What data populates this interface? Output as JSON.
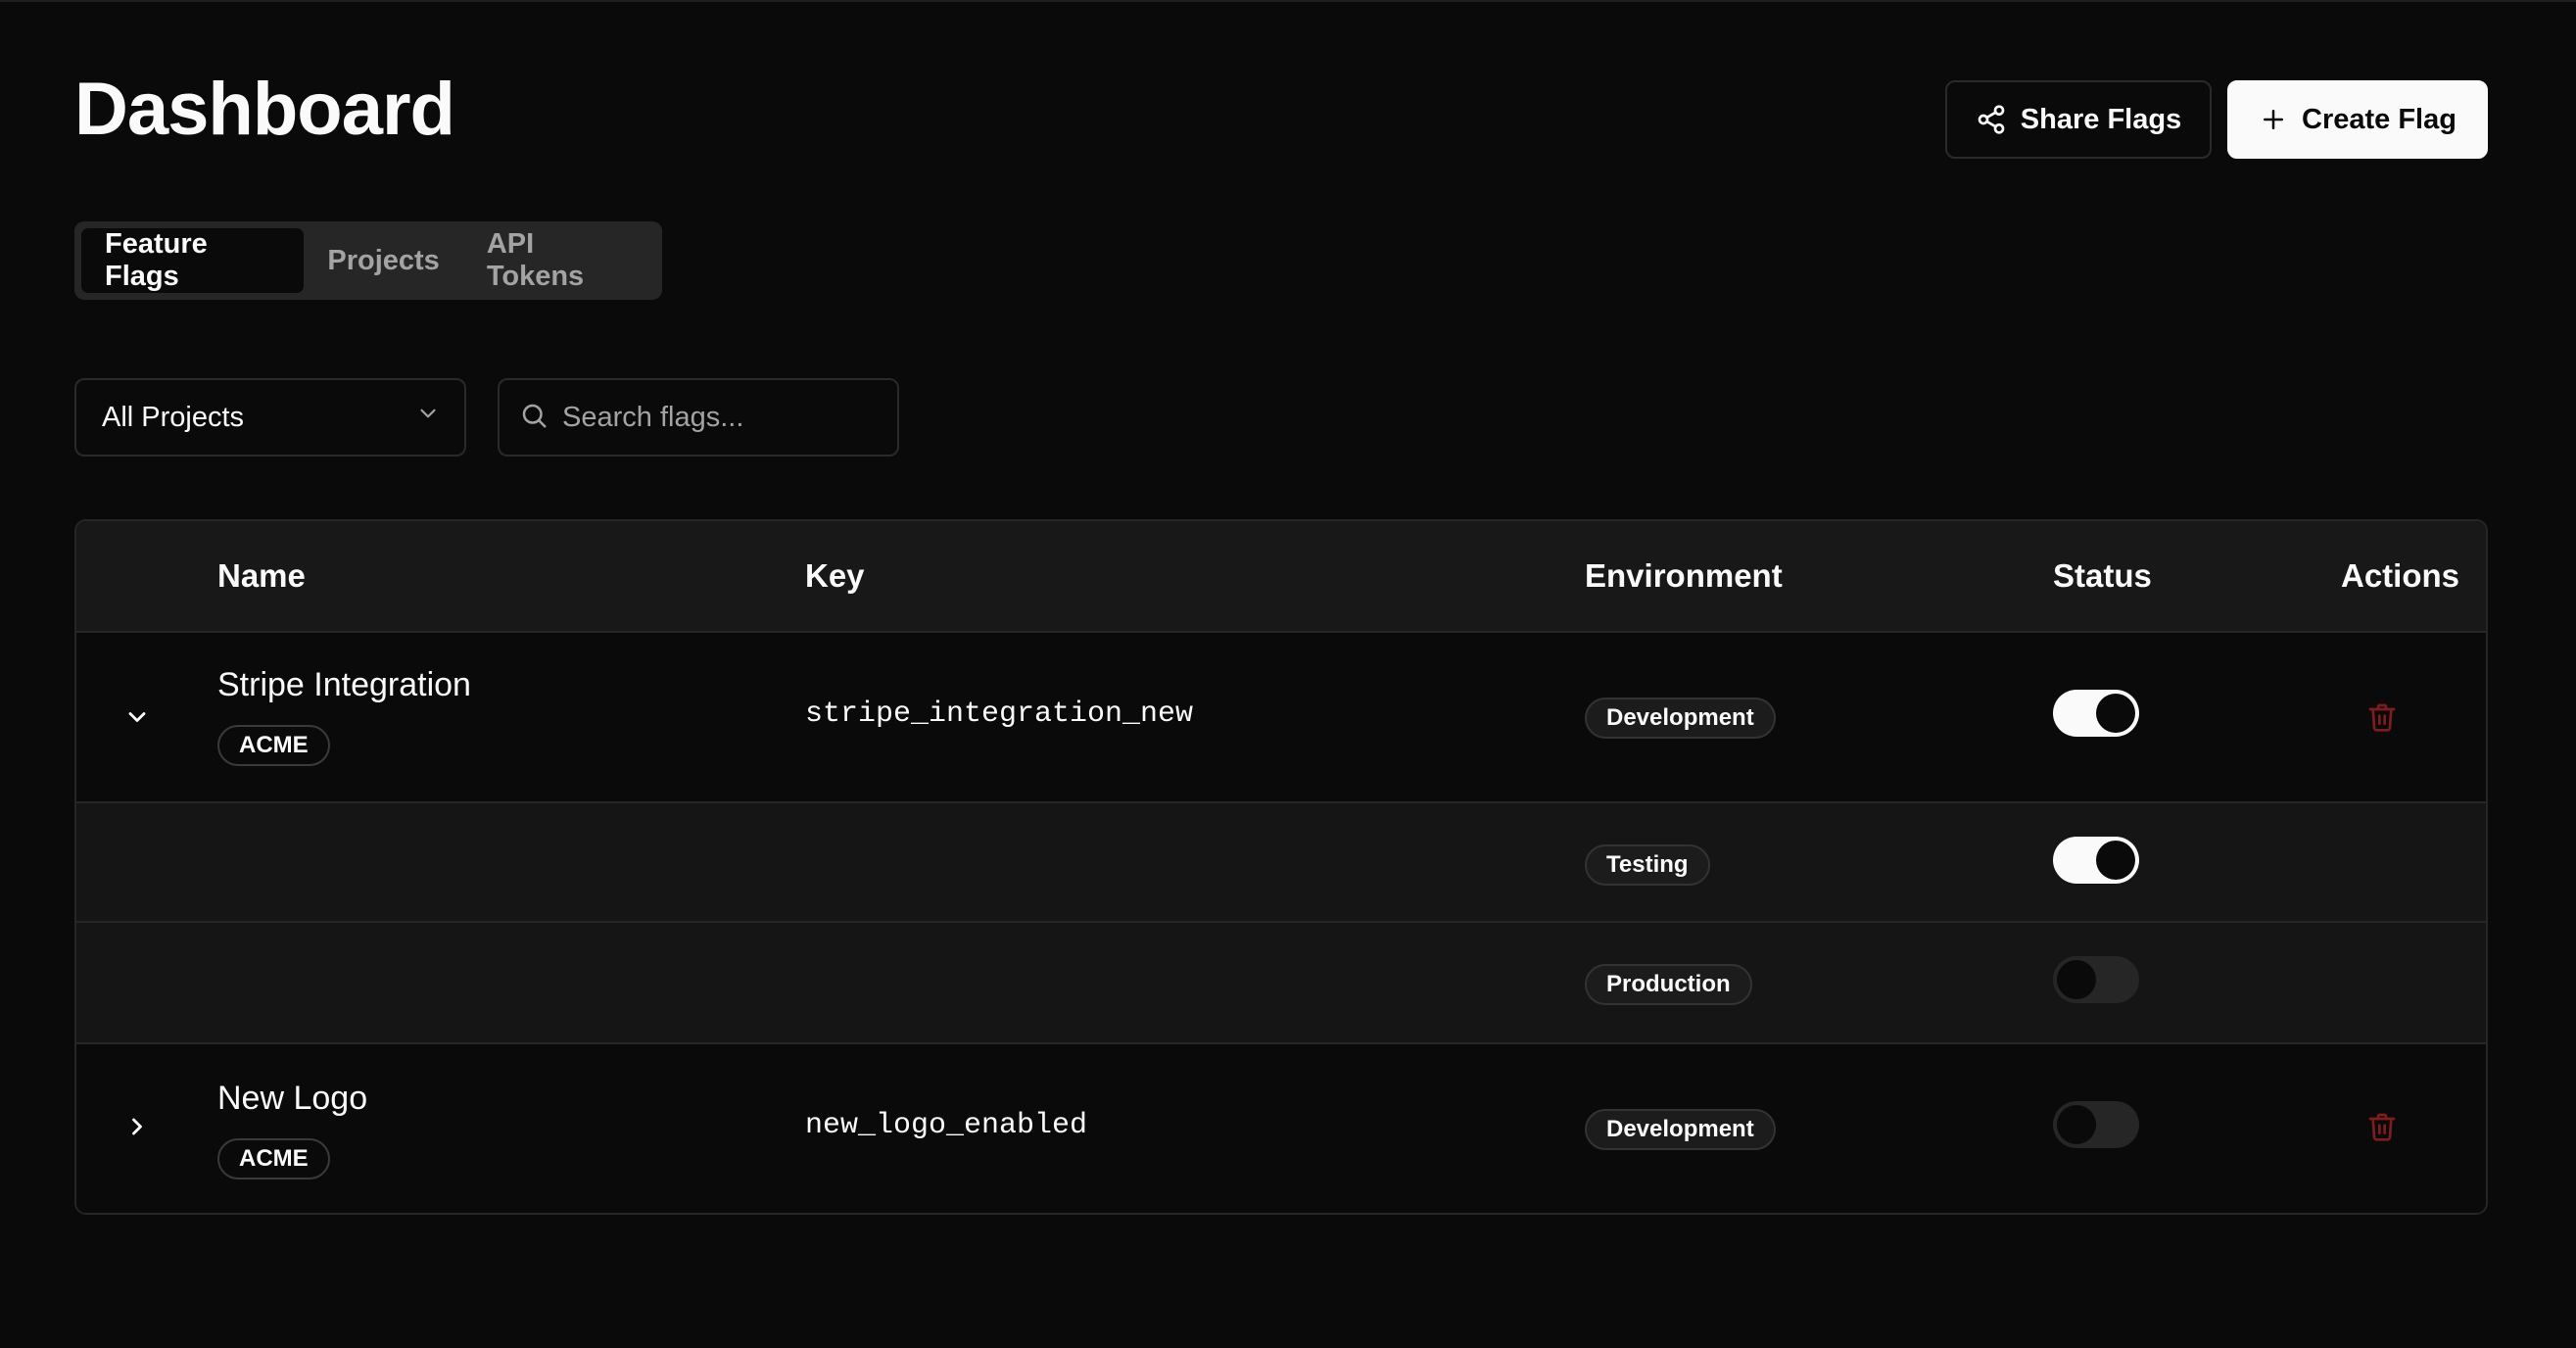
{
  "header": {
    "title": "Dashboard",
    "share_label": "Share Flags",
    "create_label": "Create Flag"
  },
  "tabs": [
    {
      "label": "Feature Flags",
      "active": true
    },
    {
      "label": "Projects",
      "active": false
    },
    {
      "label": "API Tokens",
      "active": false
    }
  ],
  "filters": {
    "project_select": "All Projects",
    "search_placeholder": "Search flags..."
  },
  "table": {
    "columns": [
      "Name",
      "Key",
      "Environment",
      "Status",
      "Actions"
    ],
    "flags": [
      {
        "name": "Stripe Integration",
        "project": "ACME",
        "key": "stripe_integration_new",
        "expanded": true,
        "environments": [
          {
            "name": "Development",
            "enabled": true
          },
          {
            "name": "Testing",
            "enabled": true
          },
          {
            "name": "Production",
            "enabled": false
          }
        ]
      },
      {
        "name": "New Logo",
        "project": "ACME",
        "key": "new_logo_enabled",
        "expanded": false,
        "environments": [
          {
            "name": "Development",
            "enabled": false
          }
        ]
      }
    ]
  },
  "colors": {
    "background": "#0a0a0a",
    "header_row": "#181818",
    "sub_row": "#151515",
    "border": "#262626",
    "delete_icon": "#7f1d1d",
    "toggle_on": "#fafafa",
    "toggle_off": "#262626"
  },
  "icons": {
    "share": "share-icon",
    "create": "plus-icon",
    "select": "chevron-down-icon",
    "search": "search-icon",
    "expanded": "chevron-down-icon",
    "collapsed": "chevron-right-icon",
    "delete": "trash-icon"
  }
}
